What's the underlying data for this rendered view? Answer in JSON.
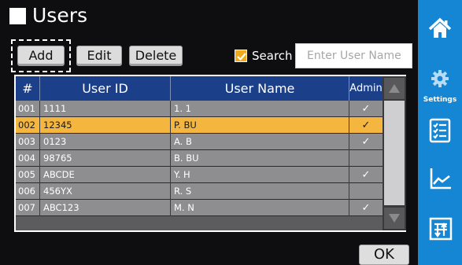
{
  "title": "Users",
  "toolbar": {
    "add_label": "Add",
    "edit_label": "Edit",
    "delete_label": "Delete",
    "search_checked": true,
    "search_label": "Search",
    "search_placeholder": "Enter User Name"
  },
  "table": {
    "headers": [
      "#",
      "User ID",
      "User Name",
      "Admin"
    ],
    "rows": [
      {
        "num": "001",
        "id": "1111",
        "name": "1. 1",
        "admin": "✓",
        "selected": false
      },
      {
        "num": "002",
        "id": "12345",
        "name": "P. BU",
        "admin": "✓",
        "selected": true
      },
      {
        "num": "003",
        "id": "0123",
        "name": "A. B",
        "admin": "✓",
        "selected": false
      },
      {
        "num": "004",
        "id": "98765",
        "name": "B. BU",
        "admin": "",
        "selected": false
      },
      {
        "num": "005",
        "id": "ABCDE",
        "name": "Y. H",
        "admin": "✓",
        "selected": false
      },
      {
        "num": "006",
        "id": "456YX",
        "name": "R. S",
        "admin": "",
        "selected": false
      },
      {
        "num": "007",
        "id": "ABC123",
        "name": "M. N",
        "admin": "✓",
        "selected": false
      }
    ]
  },
  "ok_label": "OK",
  "sidebar": {
    "items": [
      {
        "icon": "home-icon",
        "label": ""
      },
      {
        "icon": "gear-icon",
        "label": "Settings"
      },
      {
        "icon": "list-icon",
        "label": ""
      },
      {
        "icon": "chart-icon",
        "label": ""
      },
      {
        "icon": "transfer-icon",
        "label": ""
      }
    ]
  },
  "colors": {
    "sidebar": "#1486d4",
    "header": "#1c3f8a",
    "selected_row": "#f4b63f",
    "checkbox": "#f0a81c"
  }
}
